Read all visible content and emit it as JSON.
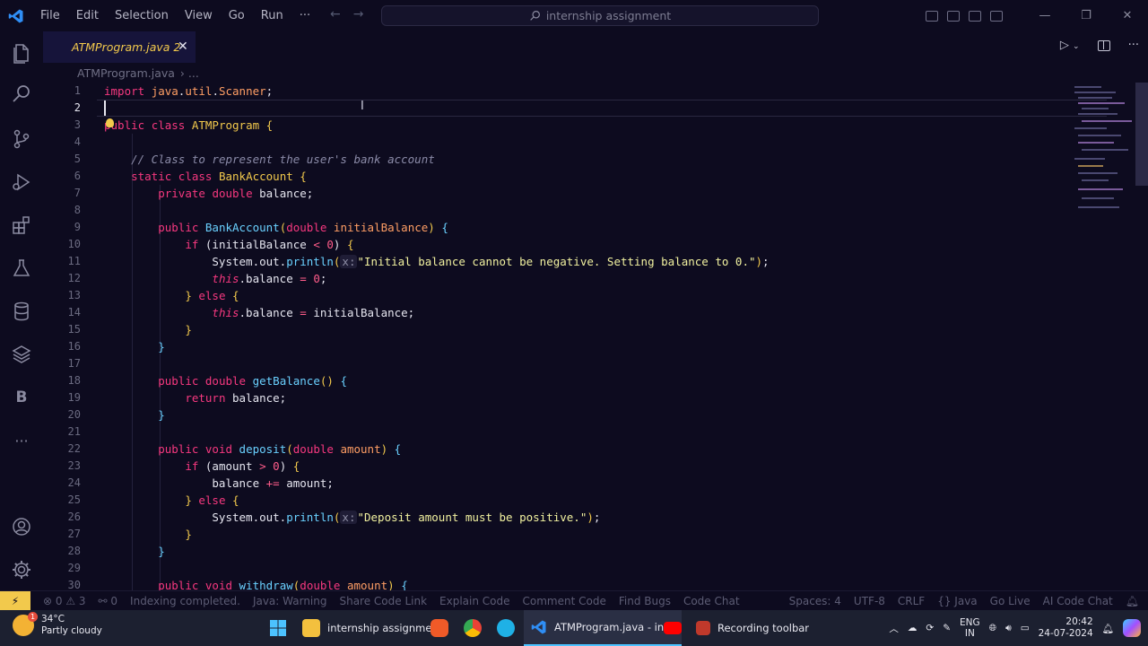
{
  "titlebar": {
    "menus": [
      "File",
      "Edit",
      "Selection",
      "View",
      "Go",
      "Run",
      "···"
    ],
    "search": "internship assignment"
  },
  "tab": {
    "label": "ATMProgram.java 2",
    "close": "✕"
  },
  "breadcrumb": {
    "file": "ATMProgram.java",
    "more": "› ..."
  },
  "code_lines": [
    {
      "n": "1",
      "tokens": [
        [
          "k",
          "import"
        ],
        [
          "p",
          " "
        ],
        [
          "v",
          "java"
        ],
        [
          "p",
          "."
        ],
        [
          "v",
          "util"
        ],
        [
          "p",
          "."
        ],
        [
          "v",
          "Scanner"
        ],
        [
          "p",
          ";"
        ]
      ]
    },
    {
      "n": "2",
      "tokens": []
    },
    {
      "n": "3",
      "tokens": [
        [
          "k",
          "public"
        ],
        [
          "p",
          " "
        ],
        [
          "k",
          "class"
        ],
        [
          "p",
          " "
        ],
        [
          "c",
          "ATMProgram"
        ],
        [
          "p",
          " "
        ],
        [
          "c",
          "{"
        ]
      ]
    },
    {
      "n": "4",
      "tokens": []
    },
    {
      "n": "5",
      "tokens": [
        [
          "p",
          "    "
        ],
        [
          "cm",
          "// Class to represent the user's bank account"
        ]
      ]
    },
    {
      "n": "6",
      "tokens": [
        [
          "p",
          "    "
        ],
        [
          "k",
          "static"
        ],
        [
          "p",
          " "
        ],
        [
          "k",
          "class"
        ],
        [
          "p",
          " "
        ],
        [
          "c",
          "BankAccount"
        ],
        [
          "p",
          " "
        ],
        [
          "c",
          "{"
        ]
      ]
    },
    {
      "n": "7",
      "tokens": [
        [
          "p",
          "        "
        ],
        [
          "k",
          "private"
        ],
        [
          "p",
          " "
        ],
        [
          "k",
          "double"
        ],
        [
          "p",
          " balance;"
        ]
      ]
    },
    {
      "n": "8",
      "tokens": []
    },
    {
      "n": "9",
      "tokens": [
        [
          "p",
          "        "
        ],
        [
          "k",
          "public"
        ],
        [
          "p",
          " "
        ],
        [
          "f",
          "BankAccount"
        ],
        [
          "c",
          "("
        ],
        [
          "k",
          "double"
        ],
        [
          "p",
          " "
        ],
        [
          "v",
          "initialBalance"
        ],
        [
          "c",
          ")"
        ],
        [
          "p",
          " "
        ],
        [
          "f",
          "{"
        ]
      ]
    },
    {
      "n": "10",
      "tokens": [
        [
          "p",
          "            "
        ],
        [
          "k",
          "if"
        ],
        [
          "p",
          " (initialBalance "
        ],
        [
          "n",
          "<"
        ],
        [
          "p",
          " "
        ],
        [
          "n",
          "0"
        ],
        [
          "p",
          ") "
        ],
        [
          "c",
          "{"
        ]
      ]
    },
    {
      "n": "11",
      "tokens": [
        [
          "p",
          "                System.out."
        ],
        [
          "f",
          "println"
        ],
        [
          "c",
          "("
        ],
        [
          "hint",
          "x:"
        ],
        [
          "s",
          "\"Initial balance cannot be negative. Setting balance to 0.\""
        ],
        [
          "c",
          ")"
        ],
        [
          "p",
          ";"
        ]
      ]
    },
    {
      "n": "12",
      "tokens": [
        [
          "p",
          "                "
        ],
        [
          "th",
          "this"
        ],
        [
          "p",
          ".balance "
        ],
        [
          "n",
          "="
        ],
        [
          "p",
          " "
        ],
        [
          "n",
          "0"
        ],
        [
          "p",
          ";"
        ]
      ]
    },
    {
      "n": "13",
      "tokens": [
        [
          "p",
          "            "
        ],
        [
          "c",
          "}"
        ],
        [
          "p",
          " "
        ],
        [
          "k",
          "else"
        ],
        [
          "p",
          " "
        ],
        [
          "c",
          "{"
        ]
      ]
    },
    {
      "n": "14",
      "tokens": [
        [
          "p",
          "                "
        ],
        [
          "th",
          "this"
        ],
        [
          "p",
          ".balance "
        ],
        [
          "n",
          "="
        ],
        [
          "p",
          " initialBalance;"
        ]
      ]
    },
    {
      "n": "15",
      "tokens": [
        [
          "p",
          "            "
        ],
        [
          "c",
          "}"
        ]
      ]
    },
    {
      "n": "16",
      "tokens": [
        [
          "p",
          "        "
        ],
        [
          "f",
          "}"
        ]
      ]
    },
    {
      "n": "17",
      "tokens": []
    },
    {
      "n": "18",
      "tokens": [
        [
          "p",
          "        "
        ],
        [
          "k",
          "public"
        ],
        [
          "p",
          " "
        ],
        [
          "k",
          "double"
        ],
        [
          "p",
          " "
        ],
        [
          "f",
          "getBalance"
        ],
        [
          "c",
          "()"
        ],
        [
          "p",
          " "
        ],
        [
          "f",
          "{"
        ]
      ]
    },
    {
      "n": "19",
      "tokens": [
        [
          "p",
          "            "
        ],
        [
          "k",
          "return"
        ],
        [
          "p",
          " balance;"
        ]
      ]
    },
    {
      "n": "20",
      "tokens": [
        [
          "p",
          "        "
        ],
        [
          "f",
          "}"
        ]
      ]
    },
    {
      "n": "21",
      "tokens": []
    },
    {
      "n": "22",
      "tokens": [
        [
          "p",
          "        "
        ],
        [
          "k",
          "public"
        ],
        [
          "p",
          " "
        ],
        [
          "k",
          "void"
        ],
        [
          "p",
          " "
        ],
        [
          "f",
          "deposit"
        ],
        [
          "c",
          "("
        ],
        [
          "k",
          "double"
        ],
        [
          "p",
          " "
        ],
        [
          "v",
          "amount"
        ],
        [
          "c",
          ")"
        ],
        [
          "p",
          " "
        ],
        [
          "f",
          "{"
        ]
      ]
    },
    {
      "n": "23",
      "tokens": [
        [
          "p",
          "            "
        ],
        [
          "k",
          "if"
        ],
        [
          "p",
          " (amount "
        ],
        [
          "n",
          ">"
        ],
        [
          "p",
          " "
        ],
        [
          "n",
          "0"
        ],
        [
          "p",
          ") "
        ],
        [
          "c",
          "{"
        ]
      ]
    },
    {
      "n": "24",
      "tokens": [
        [
          "p",
          "                balance "
        ],
        [
          "n",
          "+="
        ],
        [
          "p",
          " amount;"
        ]
      ]
    },
    {
      "n": "25",
      "tokens": [
        [
          "p",
          "            "
        ],
        [
          "c",
          "}"
        ],
        [
          "p",
          " "
        ],
        [
          "k",
          "else"
        ],
        [
          "p",
          " "
        ],
        [
          "c",
          "{"
        ]
      ]
    },
    {
      "n": "26",
      "tokens": [
        [
          "p",
          "                System.out."
        ],
        [
          "f",
          "println"
        ],
        [
          "c",
          "("
        ],
        [
          "hint",
          "x:"
        ],
        [
          "s",
          "\"Deposit amount must be positive.\""
        ],
        [
          "c",
          ")"
        ],
        [
          "p",
          ";"
        ]
      ]
    },
    {
      "n": "27",
      "tokens": [
        [
          "p",
          "            "
        ],
        [
          "c",
          "}"
        ]
      ]
    },
    {
      "n": "28",
      "tokens": [
        [
          "p",
          "        "
        ],
        [
          "f",
          "}"
        ]
      ]
    },
    {
      "n": "29",
      "tokens": []
    },
    {
      "n": "30",
      "tokens": [
        [
          "p",
          "        "
        ],
        [
          "k",
          "public"
        ],
        [
          "p",
          " "
        ],
        [
          "k",
          "void"
        ],
        [
          "p",
          " "
        ],
        [
          "f",
          "withdraw"
        ],
        [
          "c",
          "("
        ],
        [
          "k",
          "double"
        ],
        [
          "p",
          " "
        ],
        [
          "v",
          "amount"
        ],
        [
          "c",
          ")"
        ],
        [
          "p",
          " "
        ],
        [
          "f",
          "{"
        ]
      ]
    }
  ],
  "status": {
    "errors": "⊗ 0 ⚠ 3",
    "ports": "⚯ 0",
    "indexing": "Indexing completed.",
    "items_left": [
      "Java: Warning",
      "Share Code Link",
      "Explain Code",
      "Comment Code",
      "Find Bugs",
      "Code Chat"
    ],
    "items_right": [
      "Spaces: 4",
      "UTF-8",
      "CRLF",
      "{} Java",
      "Go Live",
      "AI Code Chat"
    ]
  },
  "taskbar": {
    "temp": "34°C",
    "weather": "Partly cloudy",
    "badge": "1",
    "explorer": "internship assignment",
    "vscode": "ATMProgram.java - inte",
    "recorder": "Recording toolbar",
    "lang1": "ENG",
    "lang2": "IN",
    "time": "20:42",
    "date": "24-07-2024"
  }
}
